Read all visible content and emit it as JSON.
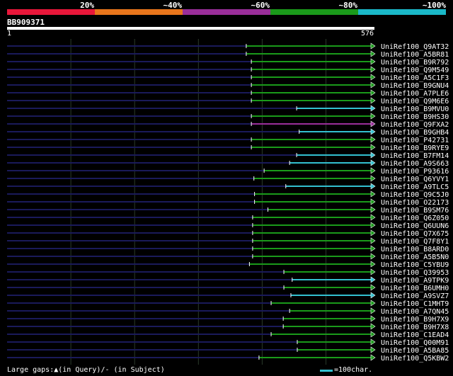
{
  "legend": {
    "labels": [
      "20%",
      "~40%",
      "~60%",
      "~80%",
      "~100%"
    ],
    "colors": [
      "#e8173a",
      "#e8761c",
      "#9a2e9a",
      "#1a9a1a",
      "#1ab8c8"
    ]
  },
  "query": {
    "id": "BB909371",
    "start_label": "1",
    "end_label": "576",
    "length": 576
  },
  "hits": [
    {
      "name": "UniRef100_Q9AT32",
      "start": 375,
      "color": "green"
    },
    {
      "name": "UniRef100_A5BR81",
      "start": 375,
      "color": "green"
    },
    {
      "name": "UniRef100_B9R792",
      "start": 383,
      "color": "green"
    },
    {
      "name": "UniRef100_Q9M549",
      "start": 383,
      "color": "green"
    },
    {
      "name": "UniRef100_A5C1F3",
      "start": 383,
      "color": "green"
    },
    {
      "name": "UniRef100_B9GNU4",
      "start": 383,
      "color": "green"
    },
    {
      "name": "UniRef100_A7PLE6",
      "start": 383,
      "color": "green"
    },
    {
      "name": "UniRef100_Q9M6E6",
      "start": 383,
      "color": "green"
    },
    {
      "name": "UniRef100_B9MVU0",
      "start": 454,
      "color": "cyan"
    },
    {
      "name": "UniRef100_B9HS30",
      "start": 383,
      "color": "green"
    },
    {
      "name": "UniRef100_Q9FXA2",
      "start": 383,
      "color": "purple"
    },
    {
      "name": "UniRef100_B9GHB4",
      "start": 458,
      "color": "cyan"
    },
    {
      "name": "UniRef100_P42731",
      "start": 383,
      "color": "green"
    },
    {
      "name": "UniRef100_B9RYE9",
      "start": 383,
      "color": "green"
    },
    {
      "name": "UniRef100_B7FM14",
      "start": 454,
      "color": "cyan"
    },
    {
      "name": "UniRef100_A9S663",
      "start": 443,
      "color": "cyan"
    },
    {
      "name": "UniRef100_P93616",
      "start": 403,
      "color": "green"
    },
    {
      "name": "UniRef100_Q6YVY1",
      "start": 387,
      "color": "green"
    },
    {
      "name": "UniRef100_A9TLC5",
      "start": 437,
      "color": "cyan"
    },
    {
      "name": "UniRef100_Q9C5J0",
      "start": 388,
      "color": "green"
    },
    {
      "name": "UniRef100_O22173",
      "start": 388,
      "color": "green"
    },
    {
      "name": "UniRef100_B9SM76",
      "start": 409,
      "color": "green"
    },
    {
      "name": "UniRef100_Q6Z050",
      "start": 385,
      "color": "green"
    },
    {
      "name": "UniRef100_Q6UUN6",
      "start": 385,
      "color": "green"
    },
    {
      "name": "UniRef100_Q7X675",
      "start": 385,
      "color": "green"
    },
    {
      "name": "UniRef100_Q7F8Y1",
      "start": 385,
      "color": "green"
    },
    {
      "name": "UniRef100_B8ARD0",
      "start": 385,
      "color": "green"
    },
    {
      "name": "UniRef100_A5B5N0",
      "start": 385,
      "color": "green"
    },
    {
      "name": "UniRef100_C5YBU9",
      "start": 380,
      "color": "green"
    },
    {
      "name": "UniRef100_Q39953",
      "start": 434,
      "color": "green"
    },
    {
      "name": "UniRef100_A9TPK9",
      "start": 447,
      "color": "cyan"
    },
    {
      "name": "UniRef100_B6UMH0",
      "start": 434,
      "color": "green"
    },
    {
      "name": "UniRef100_A9SVZ7",
      "start": 445,
      "color": "cyan"
    },
    {
      "name": "UniRef100_C1MHT9",
      "start": 414,
      "color": "green"
    },
    {
      "name": "UniRef100_A7QN45",
      "start": 443,
      "color": "green"
    },
    {
      "name": "UniRef100_B9H7X9",
      "start": 433,
      "color": "green"
    },
    {
      "name": "UniRef100_B9H7X8",
      "start": 433,
      "color": "green"
    },
    {
      "name": "UniRef100_C1EAD4",
      "start": 414,
      "color": "green"
    },
    {
      "name": "UniRef100_Q00M91",
      "start": 455,
      "color": "green"
    },
    {
      "name": "UniRef100_A5BA85",
      "start": 455,
      "color": "green"
    },
    {
      "name": "UniRef100_Q5KBW2",
      "start": 395,
      "color": "green"
    }
  ],
  "footer": {
    "gaps_text": "Large gaps:▲(in Query)/- (in Subject)",
    "scale_text": "=100char."
  },
  "colors": {
    "green": "#1a9a1a",
    "cyan": "#33c0d0",
    "purple": "#9a2e9a",
    "background_line": "#1a1a5a",
    "grid": "#2a3a2a"
  }
}
